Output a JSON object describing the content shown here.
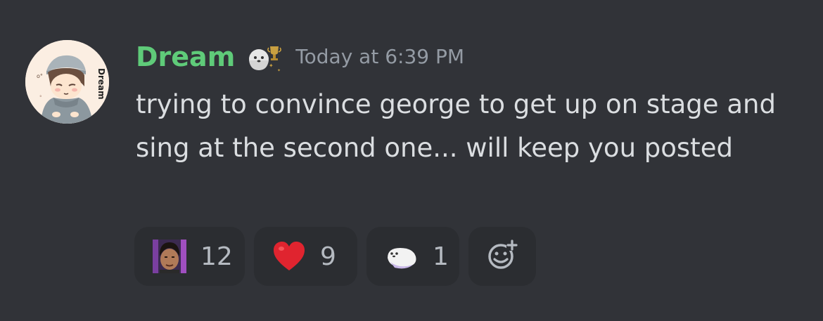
{
  "message": {
    "author": {
      "username": "Dream",
      "username_color": "#5fcb79",
      "avatar_text": "Dream",
      "role_icon": "ghost-trophy-icon"
    },
    "timestamp": "Today at 6:39 PM",
    "content": "trying to convince george to get up on stage and sing at the second one... will keep you posted"
  },
  "reactions": [
    {
      "emoji": "custom-face-emoji",
      "count": "12"
    },
    {
      "emoji": "red-heart-emoji",
      "count": "9"
    },
    {
      "emoji": "custom-ghost-emoji",
      "count": "1"
    }
  ],
  "add_reaction": {
    "icon": "add-reaction-icon"
  },
  "colors": {
    "background": "#313338",
    "reaction_bg": "#2b2d31",
    "text": "#dbdee1",
    "muted": "#949ba4"
  }
}
